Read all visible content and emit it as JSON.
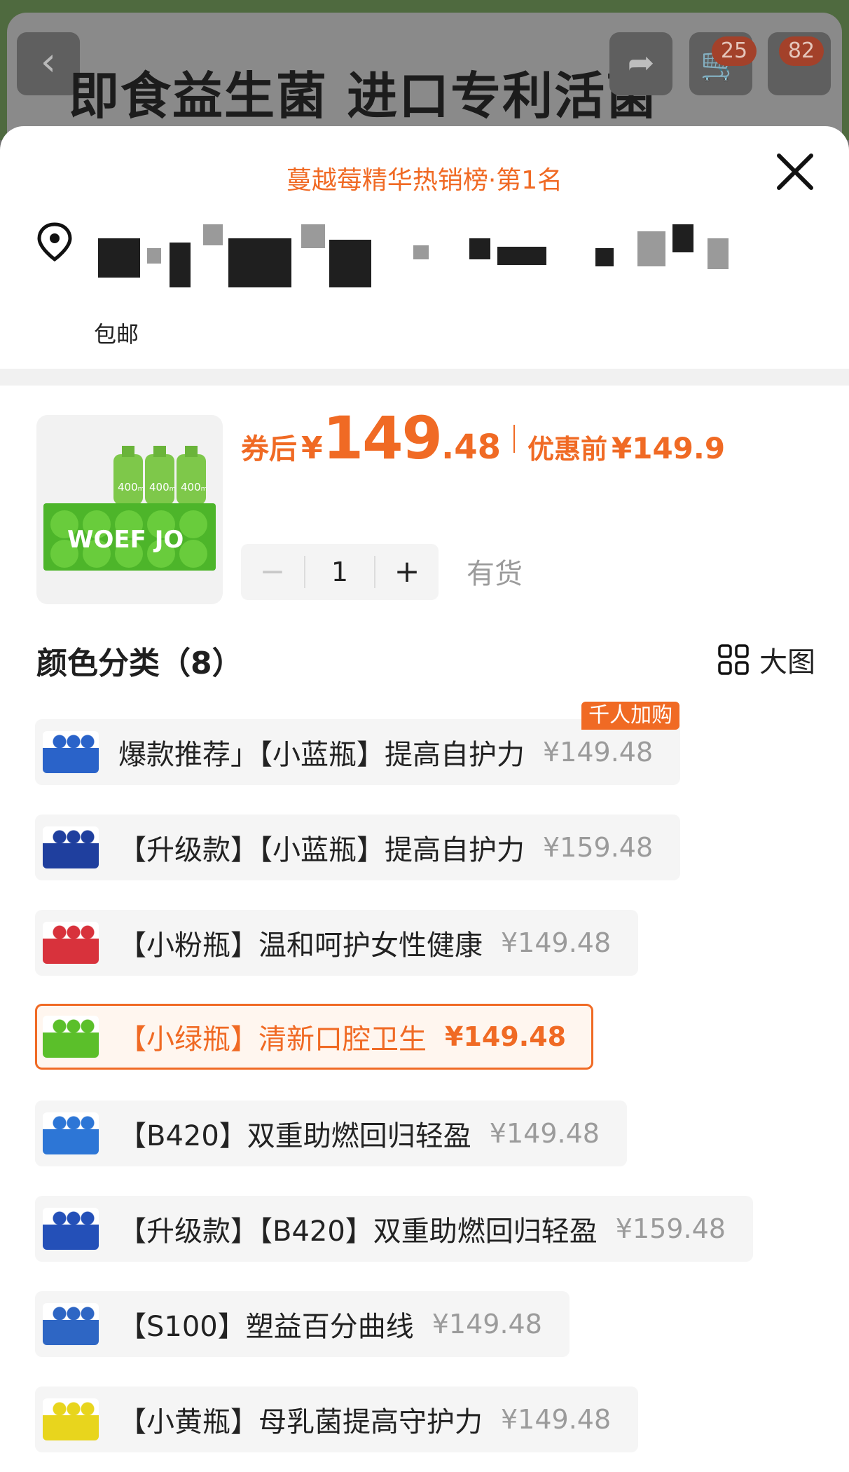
{
  "background": {
    "title": "即食益生菌   进口专利活菌",
    "cart_badge": "25",
    "more_badge": "82"
  },
  "sheet": {
    "rank_text": "蔓越莓精华热销榜·第1名",
    "postage": "包邮"
  },
  "product": {
    "image_brand": "WOEF JO",
    "bottle_label": "400ₘ",
    "price_label": "券后",
    "price_yen": "¥",
    "price_int": "149",
    "price_dec": ".48",
    "before_label": "优惠前",
    "before_price": "¥149.9",
    "quantity": "1",
    "minus": "−",
    "plus": "+",
    "stock": "有货"
  },
  "section": {
    "title": "颜色分类（8）",
    "big_view": "大图"
  },
  "options": [
    {
      "label": "爆款推荐」【小蓝瓶】提高自护力",
      "price": "¥149.48",
      "tag": "千人加购",
      "thumb_color": "#2a63c9"
    },
    {
      "label": "【升级款】【小蓝瓶】提高自护力",
      "price": "¥159.48",
      "thumb_color": "#1f3f9e"
    },
    {
      "label": "【小粉瓶】温和呵护女性健康",
      "price": "¥149.48",
      "thumb_color": "#d8323c"
    },
    {
      "label": "【小绿瓶】清新口腔卫生",
      "price": "¥149.48",
      "thumb_color": "#5bbf2a"
    },
    {
      "label": "【B420】双重助燃回归轻盈",
      "price": "¥149.48",
      "thumb_color": "#2d76d6"
    },
    {
      "label": "【升级款】【B420】双重助燃回归轻盈",
      "price": "¥159.48",
      "thumb_color": "#2450b8"
    },
    {
      "label": "【S100】塑益百分曲线",
      "price": "¥149.48",
      "thumb_color": "#2e66c4"
    },
    {
      "label": "【小黄瓶】母乳菌提高守护力",
      "price": "¥149.48",
      "thumb_color": "#e8d51d"
    }
  ],
  "colors": {
    "accent": "#f06a24",
    "muted_text": "#9b9b9b"
  }
}
